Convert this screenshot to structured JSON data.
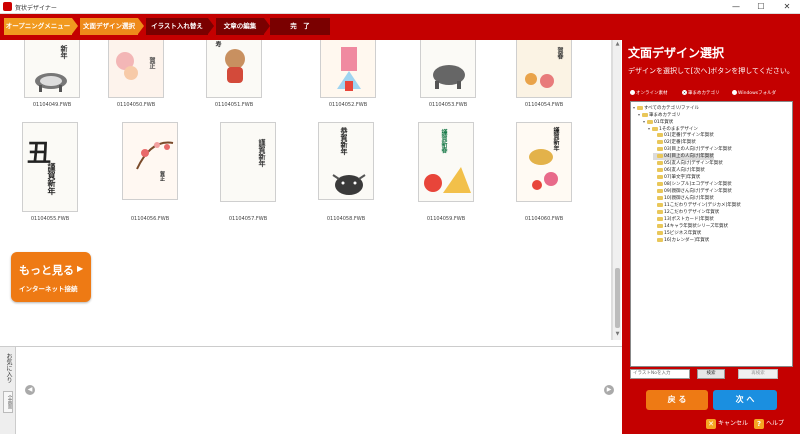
{
  "window": {
    "title": "賀状デザイナー",
    "controls": [
      "—",
      "☐",
      "✕"
    ]
  },
  "steps": [
    {
      "label": "オープニングメニュー"
    },
    {
      "label": "文面デザイン選択"
    },
    {
      "label": "イラスト入れ替え"
    },
    {
      "label": "文章の編集"
    },
    {
      "label": "完　了"
    }
  ],
  "gallery": {
    "row1_captions": [
      "01104049.FWB",
      "01104050.FWB",
      "01104051.FWB",
      "01104052.FWB",
      "01104053.FWB",
      "01104054.FWB"
    ],
    "row2_captions": [
      "01104055.FWB",
      "01104056.FWB",
      "01104057.FWB",
      "01104058.FWB",
      "01104059.FWB",
      "01104060.FWB"
    ],
    "card_texts": {
      "c1": "丑",
      "c1b": "謹賀新年",
      "c2": "賀正",
      "c3": "謹賀新年",
      "c4": "恭賀新年",
      "c5": "謹賀新春",
      "c6": "謹賀新年",
      "r1a": "新年",
      "r1b": "賀正",
      "r1c": "寿",
      "r1e": "賀春"
    }
  },
  "more_button": {
    "line1": "もっと見る",
    "line2": "インターネット接続",
    "arrow": "▶"
  },
  "favorites": {
    "label": "お気に入り",
    "side": "全画面"
  },
  "nav": {
    "prev": "◀",
    "next": "▶"
  },
  "right_panel": {
    "title": "文面デザイン選択",
    "description": "デザインを選択して[次へ]ボタンを押してください。",
    "radios": [
      {
        "label": "オンライン素材",
        "selected": false
      },
      {
        "label": "筆まめカテゴリ",
        "selected": true
      },
      {
        "label": "Windowsフォルダ",
        "selected": false
      }
    ],
    "tree": [
      {
        "label": "すべてのカテゴリ/ファイル",
        "indent": 0,
        "selected": false
      },
      {
        "label": "筆まめカテゴリ",
        "indent": 1,
        "selected": false
      },
      {
        "label": "01年賀状",
        "indent": 2,
        "selected": false
      },
      {
        "label": "1そのままデザイン",
        "indent": 3,
        "selected": false
      },
      {
        "label": "01[定番]デザイン年賀状",
        "indent": 4,
        "selected": false
      },
      {
        "label": "02[定番]年賀状",
        "indent": 4,
        "selected": false
      },
      {
        "label": "03[目上の人向け]デザイン年賀状",
        "indent": 4,
        "selected": false
      },
      {
        "label": "04[目上の人向け]年賀状",
        "indent": 4,
        "selected": true
      },
      {
        "label": "05[友人向け]デザイン年賀状",
        "indent": 4,
        "selected": false
      },
      {
        "label": "06[友人向け]年賀状",
        "indent": 4,
        "selected": false
      },
      {
        "label": "07[筆文字]年賀状",
        "indent": 4,
        "selected": false
      },
      {
        "label": "08[シンプル]エコデザイン年賀状",
        "indent": 4,
        "selected": false
      },
      {
        "label": "09[親御さん向け]デザイン年賀状",
        "indent": 4,
        "selected": false
      },
      {
        "label": "10[親御さん向け]年賀状",
        "indent": 4,
        "selected": false
      },
      {
        "label": "11こだわりデザイン[デジカメ]年賀状",
        "indent": 4,
        "selected": false
      },
      {
        "label": "12こだわりデザイン年賀状",
        "indent": 4,
        "selected": false
      },
      {
        "label": "13[ポストカード]年賀状",
        "indent": 4,
        "selected": false
      },
      {
        "label": "14キャラ年賀状シリーズ年賀状",
        "indent": 4,
        "selected": false
      },
      {
        "label": "15ビジネス年賀状",
        "indent": 4,
        "selected": false
      },
      {
        "label": "16[カレンダー]年賀状",
        "indent": 4,
        "selected": false
      }
    ],
    "search": {
      "placeholder": "イラストNoを入力",
      "button": "検索",
      "clear": "再検索"
    },
    "back": "戻 る",
    "next": "次 へ",
    "cancel": "キャンセル",
    "help": "ヘルプ"
  },
  "colors": {
    "brand_red": "#c40000",
    "orange": "#ee7a14",
    "blue": "#1b8fe0"
  }
}
